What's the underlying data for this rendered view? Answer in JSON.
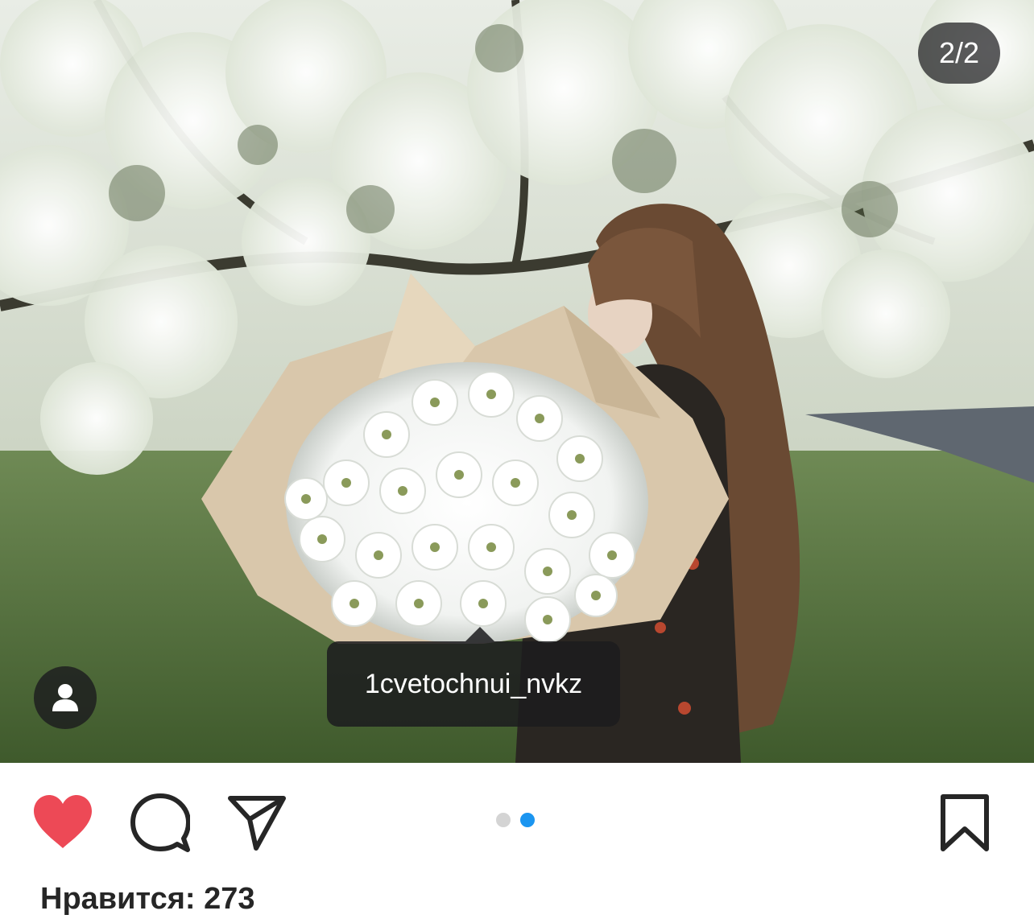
{
  "post": {
    "image_counter": "2/2",
    "tagged_user": "1cvetochnui_nvkz",
    "likes_text": "Нравится: 273",
    "carousel": {
      "total": 2,
      "active_index": 1
    },
    "liked": true
  },
  "icons": {
    "user_tag": "person-icon",
    "like": "heart-icon",
    "comment": "comment-icon",
    "share": "paper-plane-icon",
    "save": "bookmark-icon"
  },
  "colors": {
    "like_red": "#ED4956",
    "active_dot": "#1b95f0",
    "inactive_dot": "#d4d4d4",
    "overlay_dark": "#1c1c1e",
    "text": "#262626"
  }
}
